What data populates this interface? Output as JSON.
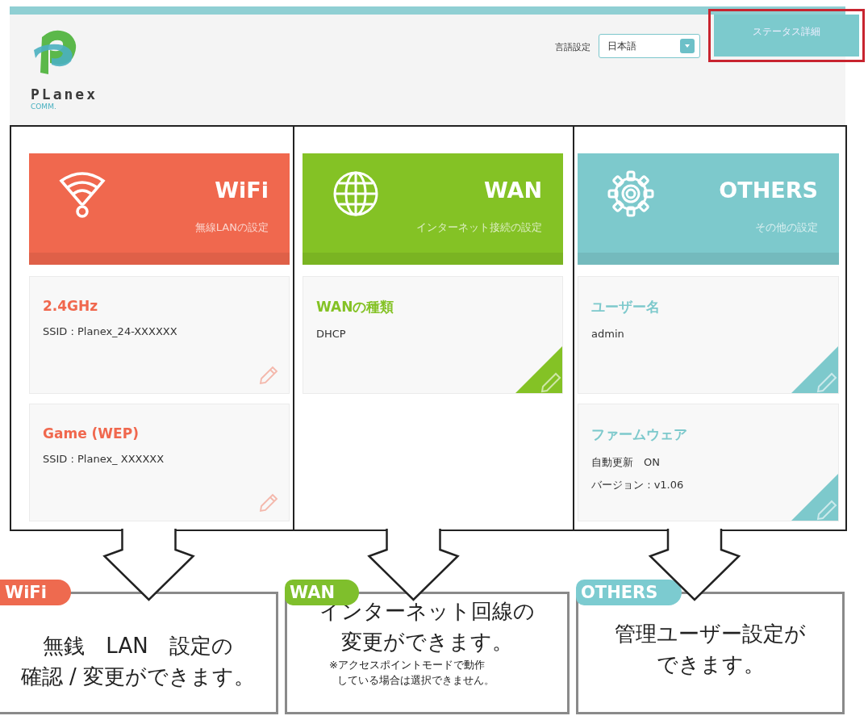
{
  "header": {
    "logo": {
      "brand": "PLanex",
      "sub": "COMM."
    },
    "language": {
      "label": "言語設定",
      "value": "日本語"
    },
    "status_button": {
      "label": "ステータス詳細",
      "highlighted": true
    }
  },
  "panels": [
    {
      "kind": "wifi",
      "color": "#f0684e",
      "title": "WiFi",
      "subtitle": "無線LANの設定",
      "cards": [
        {
          "title": "2.4GHz",
          "lines": [
            "SSID : Planex_24-XXXXXX"
          ]
        },
        {
          "title": "Game (WEP)",
          "lines": [
            "SSID : Planex_ XXXXXX"
          ]
        }
      ]
    },
    {
      "kind": "wan",
      "color": "#84c225",
      "title": "WAN",
      "subtitle": "インターネット接続の設定",
      "cards": [
        {
          "title": "WANの種類",
          "lines": [
            "DHCP"
          ]
        }
      ]
    },
    {
      "kind": "others",
      "color": "#7dc9cc",
      "title": "OTHERS",
      "subtitle": "その他の設定",
      "cards": [
        {
          "title": "ユーザー名",
          "lines": [
            "admin"
          ]
        },
        {
          "title": "ファームウェア",
          "lines": [
            "自動更新　ON",
            "バージョン : v1.06"
          ]
        }
      ]
    }
  ],
  "callouts": [
    {
      "tag": "WiFi",
      "color": "#ee6a4f",
      "lines": [
        "無銭　LAN　設定の",
        "確認 / 変更ができます。"
      ]
    },
    {
      "tag": "WAN",
      "color": "#7fbf2c",
      "lines": [
        "インターネット回線の",
        "変更ができます。"
      ],
      "notes": [
        "※アクセスポイントモードで動作",
        "している場合は選択できません。"
      ]
    },
    {
      "tag": "OTHERS",
      "color": "#7ccbd0",
      "lines": [
        "管理ユーザー設定が",
        "できます。"
      ]
    }
  ]
}
